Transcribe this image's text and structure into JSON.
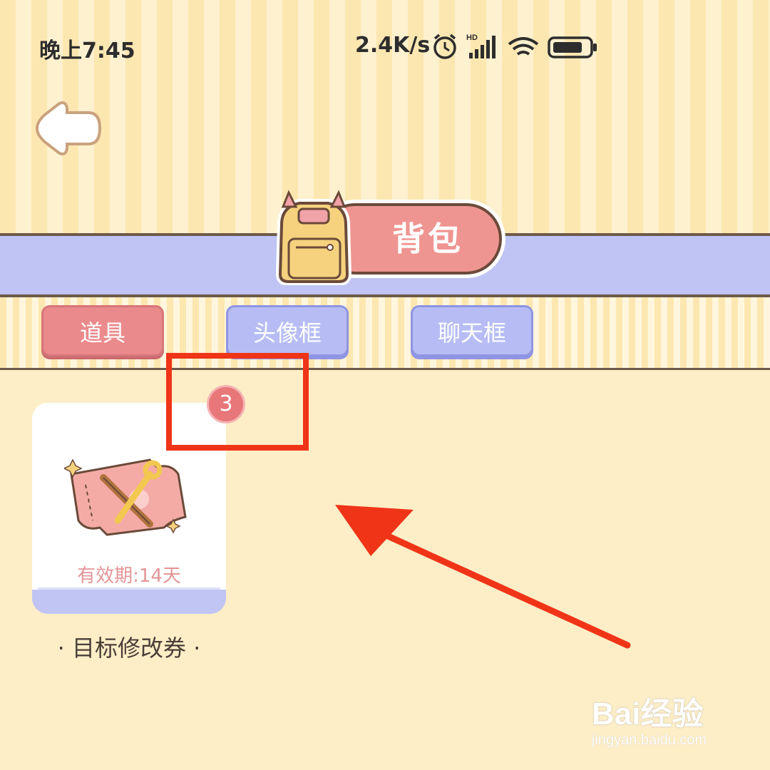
{
  "status_bar": {
    "time": "晚上7:45",
    "speed": "2.4K/s",
    "icons": [
      "alarm-icon",
      "hd-signal-icon",
      "wifi-icon",
      "battery-icon"
    ]
  },
  "header": {
    "back_icon": "back-arrow-icon",
    "title": "背包",
    "title_icon": "backpack-icon"
  },
  "tabs": [
    {
      "label": "道具",
      "active": true
    },
    {
      "label": "头像框",
      "active": false
    },
    {
      "label": "聊天框",
      "active": false
    }
  ],
  "items": [
    {
      "name": "· 目标修改券 ·",
      "validity": "有效期:14天",
      "count": "3",
      "icon": "ticket-wrench-icon"
    }
  ],
  "watermark": {
    "brand": "Bai经验",
    "url": "jingyan.baidu.com"
  },
  "colors": {
    "accent_red": "#ea8a8c",
    "accent_blue": "#b7bdf4",
    "annotation_red": "#f03418",
    "background": "#fdeec7"
  }
}
